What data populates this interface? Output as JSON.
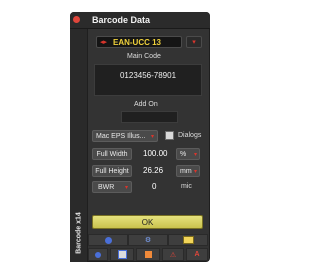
{
  "window": {
    "title": "Barcode Data"
  },
  "symbology": {
    "selected": "EAN-UCC 13"
  },
  "main_code": {
    "label": "Main Code",
    "value": "0123456-78901"
  },
  "add_on": {
    "label": "Add On",
    "value": ""
  },
  "output_format": {
    "selected": "Mac EPS Illus...",
    "dialogs_label": "Dialogs"
  },
  "full_width": {
    "label": "Full Width",
    "value": "100.00",
    "unit": "%"
  },
  "full_height": {
    "label": "Full Height",
    "value": "26.26",
    "unit": "mm"
  },
  "bwr": {
    "label": "BWR",
    "value": "0",
    "unit": "mic"
  },
  "ok": {
    "label": "OK"
  },
  "side": {
    "label": "Barcode x14"
  },
  "toolbar_icons": [
    "info-icon",
    "settings-icon",
    "folder-icon",
    "info-icon",
    "export-icon",
    "color-icon",
    "warning-icon",
    "text-icon"
  ],
  "colors": {
    "panel": "#333333",
    "ok": "#dcd66a",
    "dot_red": "#e0463b",
    "dot_yellow": "#e8b13a",
    "accent_yellow": "#f0d23c"
  }
}
